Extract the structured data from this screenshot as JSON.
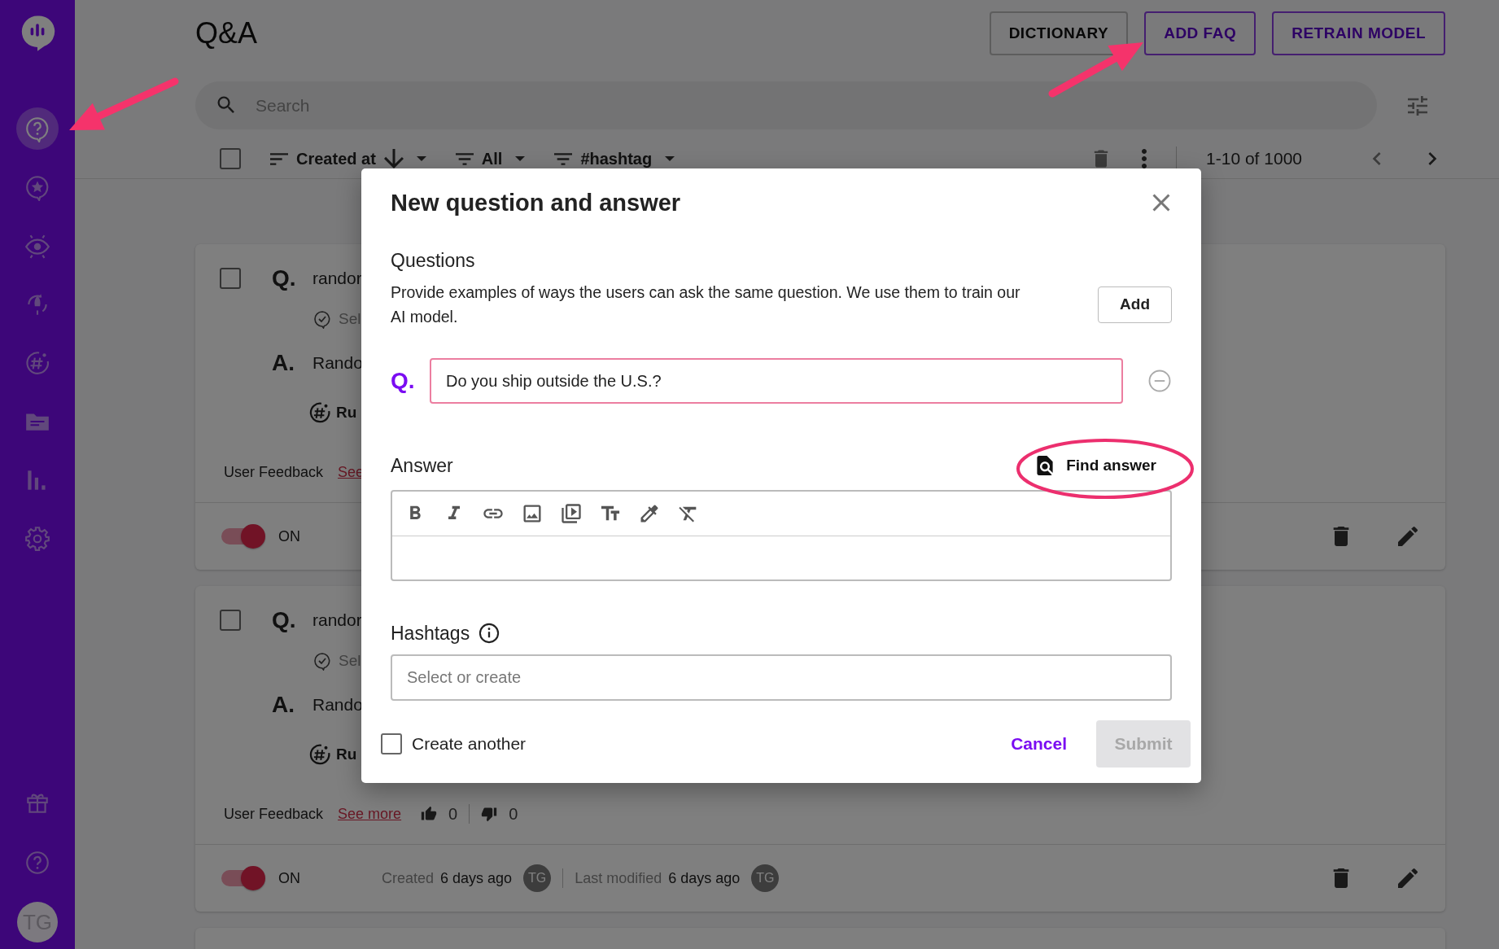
{
  "sidebar": {
    "items": [
      {
        "kind": "logo",
        "selected": false
      },
      {
        "kind": "qa",
        "selected": true
      },
      {
        "kind": "star",
        "selected": false
      },
      {
        "kind": "eye",
        "selected": false
      },
      {
        "kind": "rocket",
        "selected": false
      },
      {
        "kind": "hashtag",
        "selected": false
      },
      {
        "kind": "folder",
        "selected": false
      },
      {
        "kind": "chart",
        "selected": false
      },
      {
        "kind": "gear",
        "selected": false
      }
    ],
    "footer_items": [
      {
        "kind": "gift",
        "selected": false
      },
      {
        "kind": "help",
        "selected": false
      }
    ],
    "avatar": "TG"
  },
  "header": {
    "title": "Q&A",
    "buttons": [
      {
        "label": "DICTIONARY",
        "kind": "neutral"
      },
      {
        "label": "ADD FAQ",
        "kind": "primary"
      },
      {
        "label": "RETRAIN MODEL",
        "kind": "primary"
      }
    ]
  },
  "search": {
    "placeholder": "Search"
  },
  "toolbar": {
    "select_all_checked": false,
    "filters": [
      {
        "label": "Created at",
        "kind": "sort"
      },
      {
        "label": "All",
        "kind": "filter"
      },
      {
        "label": "#hashtag",
        "kind": "filter"
      }
    ],
    "pagination": "1-10 of 1000"
  },
  "cards": [
    {
      "checked": false,
      "question_marker": "Q.",
      "answer_marker": "A.",
      "question": "randor",
      "source": "Sel",
      "answer": "Rando",
      "hashtag": "Ru",
      "feedback_label": "User Feedback",
      "feedback_link": "See",
      "enabled": true,
      "status": "ON"
    },
    {
      "checked": false,
      "question_marker": "Q.",
      "answer_marker": "A.",
      "question": "randor",
      "source": "Sel",
      "answer": "Rando",
      "hashtag": "Ru",
      "feedback_label": "User Feedback",
      "feedback_link": "See more",
      "likes": "0",
      "dislikes": "0",
      "enabled": true,
      "status": "ON",
      "created_label": "Created",
      "created": "6 days ago",
      "created_by": "TG",
      "modified_label": "Last modified",
      "modified": "6 days ago",
      "modified_by": "TG"
    }
  ],
  "dialog": {
    "title": "New question and answer",
    "questions": {
      "heading": "Questions",
      "description": "Provide examples of ways the users can ask the same question. We use them to train our AI model.",
      "add_button": "Add",
      "items": [
        {
          "marker": "Q.",
          "value": "Do you ship outside the U.S.?"
        }
      ]
    },
    "answer": {
      "heading": "Answer",
      "find_button": "Find answer",
      "tools": [
        {
          "kind": "bold"
        },
        {
          "kind": "italic"
        },
        {
          "kind": "link"
        },
        {
          "kind": "image"
        },
        {
          "kind": "video"
        },
        {
          "kind": "text-size"
        },
        {
          "kind": "color"
        },
        {
          "kind": "clear-format"
        }
      ]
    },
    "hashtags": {
      "heading": "Hashtags",
      "placeholder": "Select or create"
    },
    "create_another": {
      "label": "Create another",
      "checked": false
    },
    "cancel": "Cancel",
    "submit": {
      "label": "Submit",
      "disabled": true
    }
  }
}
